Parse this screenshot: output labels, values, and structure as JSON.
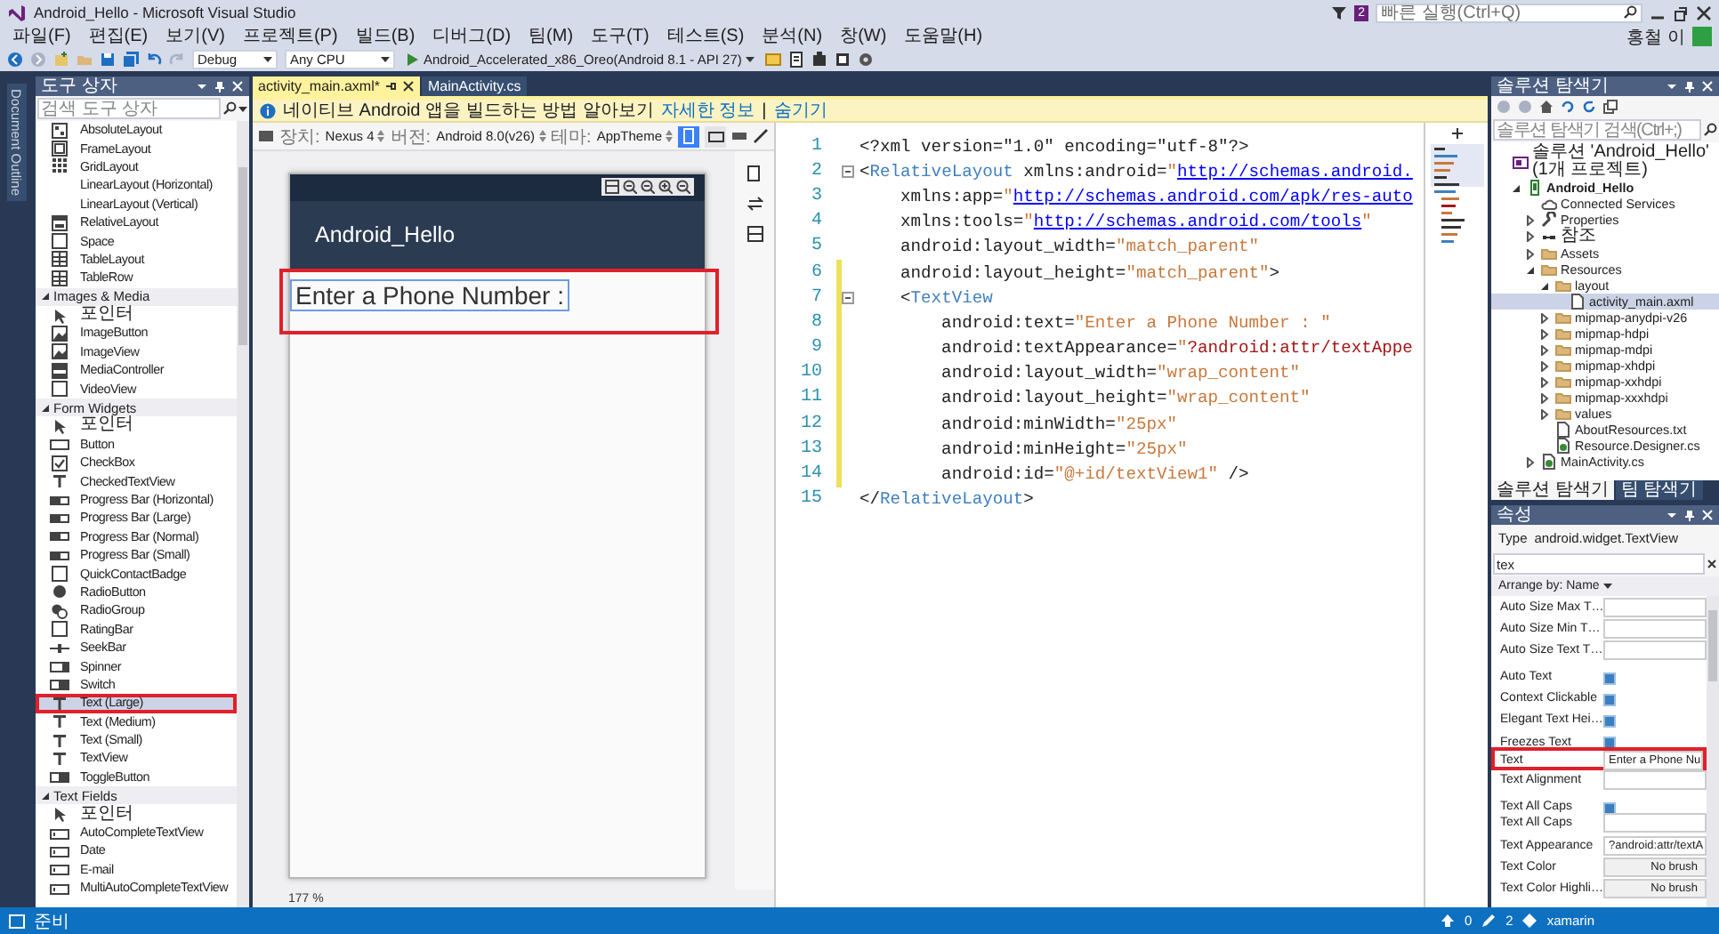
{
  "window": {
    "title": "Android_Hello - Microsoft Visual Studio",
    "notification_count": "2",
    "quick_launch": {
      "placeholder": "빠른 실행(Ctrl+Q)"
    },
    "user": "홍철 이"
  },
  "menu": [
    "파일(F)",
    "편집(E)",
    "보기(V)",
    "프로젝트(P)",
    "빌드(B)",
    "디버그(D)",
    "팀(M)",
    "도구(T)",
    "테스트(S)",
    "분석(N)",
    "창(W)",
    "도움말(H)"
  ],
  "toolbar": {
    "configuration": "Debug",
    "platform": "Any CPU",
    "device": "Android_Accelerated_x86_Oreo(Android 8.1 - API 27)"
  },
  "side_tab": "Document Outline",
  "toolbox": {
    "title": "도구 상자",
    "search": {
      "placeholder": "검색 도구 상자"
    },
    "groups": [
      {
        "items": [
          {
            "label": "AbsoluteLayout",
            "kind": "absolute",
            "selected": false
          },
          {
            "label": "FrameLayout",
            "kind": "frame",
            "selected": false
          },
          {
            "label": "GridLayout",
            "kind": "grid",
            "selected": false
          },
          {
            "label": "LinearLayout (Horizontal)",
            "kind": "linear",
            "selected": false
          },
          {
            "label": "LinearLayout (Vertical)",
            "kind": "linear",
            "selected": false
          },
          {
            "label": "RelativeLayout",
            "kind": "relative",
            "selected": false
          },
          {
            "label": "Space",
            "kind": "space",
            "selected": false
          },
          {
            "label": "TableLayout",
            "kind": "table",
            "selected": false
          },
          {
            "label": "TableRow",
            "kind": "table",
            "selected": false
          }
        ]
      },
      {
        "title": "Images & Media",
        "expanded": true,
        "items": [
          {
            "label": "포인터",
            "kind": "pointer",
            "selected": false
          },
          {
            "label": "ImageButton",
            "kind": "image",
            "selected": false
          },
          {
            "label": "ImageView",
            "kind": "image",
            "selected": false
          },
          {
            "label": "MediaController",
            "kind": "media",
            "selected": false
          },
          {
            "label": "VideoView",
            "kind": "space",
            "selected": false
          }
        ]
      },
      {
        "title": "Form Widgets",
        "expanded": true,
        "items": [
          {
            "label": "포인터",
            "kind": "pointer",
            "selected": false
          },
          {
            "label": "Button",
            "kind": "button",
            "selected": false
          },
          {
            "label": "CheckBox",
            "kind": "check",
            "selected": false
          },
          {
            "label": "CheckedTextView",
            "kind": "text",
            "selected": false
          },
          {
            "label": "Progress Bar (Horizontal)",
            "kind": "progress",
            "selected": false
          },
          {
            "label": "Progress Bar (Large)",
            "kind": "progress",
            "selected": false
          },
          {
            "label": "Progress Bar (Normal)",
            "kind": "progress",
            "selected": false
          },
          {
            "label": "Progress Bar (Small)",
            "kind": "progress",
            "selected": false
          },
          {
            "label": "QuickContactBadge",
            "kind": "space",
            "selected": false
          },
          {
            "label": "RadioButton",
            "kind": "radio",
            "selected": false
          },
          {
            "label": "RadioGroup",
            "kind": "radiogroup",
            "selected": false
          },
          {
            "label": "RatingBar",
            "kind": "space",
            "selected": false
          },
          {
            "label": "SeekBar",
            "kind": "seek",
            "selected": false
          },
          {
            "label": "Spinner",
            "kind": "spinner",
            "selected": false
          },
          {
            "label": "Switch",
            "kind": "switch",
            "selected": false
          },
          {
            "label": "Text (Large)",
            "kind": "text",
            "selected": true,
            "annotated": true
          },
          {
            "label": "Text (Medium)",
            "kind": "text",
            "selected": false
          },
          {
            "label": "Text (Small)",
            "kind": "text",
            "selected": false
          },
          {
            "label": "TextView",
            "kind": "text",
            "selected": false
          },
          {
            "label": "ToggleButton",
            "kind": "switch",
            "selected": false
          }
        ]
      },
      {
        "title": "Text Fields",
        "expanded": true,
        "items": [
          {
            "label": "포인터",
            "kind": "pointer",
            "selected": false
          },
          {
            "label": "AutoCompleteTextView",
            "kind": "field",
            "selected": false
          },
          {
            "label": "Date",
            "kind": "field",
            "selected": false
          },
          {
            "label": "E-mail",
            "kind": "field",
            "selected": false
          },
          {
            "label": "MultiAutoCompleteTextView",
            "kind": "field",
            "selected": false
          }
        ]
      }
    ]
  },
  "documents": {
    "tabs": [
      {
        "label": "activity_main.axml*",
        "selected": true
      },
      {
        "label": "MainActivity.cs",
        "selected": false
      }
    ],
    "info_bar": {
      "message": "네이티브 Android 앱을 빌드하는 방법 알아보기",
      "link": "자세한 정보",
      "separator": "|",
      "dismiss": "숨기기"
    }
  },
  "designer": {
    "fields": [
      {
        "label": "장치:",
        "value": "Nexus 4"
      },
      {
        "label": "버전:",
        "value": "Android 8.0(v26)"
      },
      {
        "label": "테마:",
        "value": "AppTheme"
      }
    ],
    "orientations": [
      {
        "kind": "portrait",
        "selected": true
      },
      {
        "kind": "landscape",
        "selected": false
      }
    ],
    "phone": {
      "app_title": "Android_Hello",
      "text_view": {
        "text": "Enter a Phone Number :",
        "selected": true,
        "annotated": true
      }
    },
    "zoom": "177 %"
  },
  "code_editor": {
    "lines": [
      {
        "number": "1",
        "changed": false,
        "fold": false,
        "tokens": [
          {
            "kind": "plain",
            "text": "<?xml version=\"1.0\" encoding=\"utf-8\"?>"
          }
        ]
      },
      {
        "number": "2",
        "changed": false,
        "fold": true,
        "tokens": [
          {
            "kind": "plain",
            "text": "<"
          },
          {
            "kind": "tag",
            "text": "RelativeLayout"
          },
          {
            "kind": "plain",
            "text": " xmlns:android="
          },
          {
            "kind": "value",
            "text": "\""
          },
          {
            "kind": "link",
            "text": "http://schemas.android."
          }
        ]
      },
      {
        "number": "3",
        "changed": false,
        "fold": false,
        "tokens": [
          {
            "kind": "plain",
            "text": "    xmlns:app="
          },
          {
            "kind": "value",
            "text": "\""
          },
          {
            "kind": "link",
            "text": "http://schemas.android.com/apk/res-auto"
          }
        ]
      },
      {
        "number": "4",
        "changed": false,
        "fold": false,
        "tokens": [
          {
            "kind": "plain",
            "text": "    xmlns:tools="
          },
          {
            "kind": "value",
            "text": "\""
          },
          {
            "kind": "link",
            "text": "http://schemas.android.com/tools"
          },
          {
            "kind": "value",
            "text": "\""
          }
        ]
      },
      {
        "number": "5",
        "changed": false,
        "fold": false,
        "tokens": [
          {
            "kind": "plain",
            "text": "    android:layout_width="
          },
          {
            "kind": "value",
            "text": "\"match_parent\""
          }
        ]
      },
      {
        "number": "6",
        "changed": true,
        "fold": false,
        "tokens": [
          {
            "kind": "plain",
            "text": "    android:layout_height="
          },
          {
            "kind": "value",
            "text": "\"match_parent\""
          },
          {
            "kind": "plain",
            "text": ">"
          }
        ]
      },
      {
        "number": "7",
        "changed": true,
        "fold": true,
        "tokens": [
          {
            "kind": "plain",
            "text": "    <"
          },
          {
            "kind": "tag",
            "text": "TextView"
          }
        ]
      },
      {
        "number": "8",
        "changed": true,
        "fold": false,
        "tokens": [
          {
            "kind": "plain",
            "text": "        android:text="
          },
          {
            "kind": "value",
            "text": "\"Enter a Phone Number : \""
          }
        ]
      },
      {
        "number": "9",
        "changed": true,
        "fold": false,
        "tokens": [
          {
            "kind": "plain",
            "text": "        android:textAppearance="
          },
          {
            "kind": "value",
            "text": "\""
          },
          {
            "kind": "resource",
            "text": "?android:attr/textAppe"
          }
        ]
      },
      {
        "number": "10",
        "changed": true,
        "fold": false,
        "tokens": [
          {
            "kind": "plain",
            "text": "        android:layout_width="
          },
          {
            "kind": "value",
            "text": "\"wrap_content\""
          }
        ]
      },
      {
        "number": "11",
        "changed": true,
        "fold": false,
        "tokens": [
          {
            "kind": "plain",
            "text": "        android:layout_height="
          },
          {
            "kind": "value",
            "text": "\"wrap_content\""
          }
        ]
      },
      {
        "number": "12",
        "changed": true,
        "fold": false,
        "tokens": [
          {
            "kind": "plain",
            "text": "        android:minWidth="
          },
          {
            "kind": "value",
            "text": "\"25px\""
          }
        ]
      },
      {
        "number": "13",
        "changed": true,
        "fold": false,
        "tokens": [
          {
            "kind": "plain",
            "text": "        android:minHeight="
          },
          {
            "kind": "value",
            "text": "\"25px\""
          }
        ]
      },
      {
        "number": "14",
        "changed": true,
        "fold": false,
        "tokens": [
          {
            "kind": "plain",
            "text": "        android:id="
          },
          {
            "kind": "value",
            "text": "\"@+id/textView1\""
          },
          {
            "kind": "plain",
            "text": " />"
          }
        ]
      },
      {
        "number": "15",
        "changed": false,
        "fold": false,
        "tokens": [
          {
            "kind": "plain",
            "text": "</"
          },
          {
            "kind": "tag",
            "text": "RelativeLayout"
          },
          {
            "kind": "plain",
            "text": ">"
          }
        ]
      }
    ]
  },
  "solution_explorer": {
    "title": "솔루션 탐색기",
    "search": {
      "placeholder": "솔루션 탐색기 검색(Ctrl+;)"
    },
    "tree": [
      {
        "label": "솔루션 'Android_Hello' (1개 프로젝트)",
        "kind": "solution",
        "selected": false,
        "children": [
          {
            "label": "Android_Hello",
            "kind": "project",
            "expanded": true,
            "startup": true,
            "selected": false,
            "children": [
              {
                "label": "Connected Services",
                "kind": "cloud",
                "selected": false
              },
              {
                "label": "Properties",
                "kind": "wrench",
                "expanded": false,
                "selected": false
              },
              {
                "label": "참조",
                "kind": "refs",
                "expanded": false,
                "selected": false
              },
              {
                "label": "Assets",
                "kind": "folder",
                "expanded": false,
                "selected": false
              },
              {
                "label": "Resources",
                "kind": "folder",
                "expanded": true,
                "selected": false,
                "children": [
                  {
                    "label": "layout",
                    "kind": "folder",
                    "expanded": true,
                    "selected": false,
                    "children": [
                      {
                        "label": "activity_main.axml",
                        "kind": "file",
                        "selected": true
                      }
                    ]
                  },
                  {
                    "label": "mipmap-anydpi-v26",
                    "kind": "folder",
                    "expanded": false,
                    "selected": false
                  },
                  {
                    "label": "mipmap-hdpi",
                    "kind": "folder",
                    "expanded": false,
                    "selected": false
                  },
                  {
                    "label": "mipmap-mdpi",
                    "kind": "folder",
                    "expanded": false,
                    "selected": false
                  },
                  {
                    "label": "mipmap-xhdpi",
                    "kind": "folder",
                    "expanded": false,
                    "selected": false
                  },
                  {
                    "label": "mipmap-xxhdpi",
                    "kind": "folder",
                    "expanded": false,
                    "selected": false
                  },
                  {
                    "label": "mipmap-xxxhdpi",
                    "kind": "folder",
                    "expanded": false,
                    "selected": false
                  },
                  {
                    "label": "values",
                    "kind": "folder",
                    "expanded": false,
                    "selected": false
                  },
                  {
                    "label": "AboutResources.txt",
                    "kind": "file",
                    "selected": false
                  },
                  {
                    "label": "Resource.Designer.cs",
                    "kind": "cs",
                    "selected": false
                  }
                ]
              },
              {
                "label": "MainActivity.cs",
                "kind": "cs",
                "expanded": false,
                "selected": false
              }
            ]
          }
        ]
      }
    ],
    "tabs": [
      {
        "label": "솔루션 탐색기",
        "selected": true
      },
      {
        "label": "팀 탐색기",
        "selected": false
      }
    ]
  },
  "properties": {
    "title": "속성",
    "type_label": "Type",
    "type_value": "android.widget.TextView",
    "search": {
      "value": "tex"
    },
    "arrange": "Arrange by: Name",
    "rows": [
      {
        "name": "Auto Size Max T…",
        "kind": "field"
      },
      {
        "name": "Auto Size Min T…",
        "kind": "field"
      },
      {
        "name": "Auto Size Text T…",
        "kind": "field"
      },
      {
        "name": "Auto Text",
        "kind": "toggle",
        "checked": true
      },
      {
        "name": "Context Clickable",
        "kind": "toggle",
        "checked": true
      },
      {
        "name": "Elegant Text Hei…",
        "kind": "toggle",
        "checked": true
      },
      {
        "name": "Freezes Text",
        "kind": "toggle",
        "checked": true
      },
      {
        "name": "Text",
        "kind": "field",
        "value": "Enter a Phone Nu",
        "annotated": true
      },
      {
        "name": "Text Alignment",
        "kind": "field"
      },
      {
        "name": "Text All Caps",
        "kind": "toggle",
        "checked": true
      },
      {
        "name": "Text All Caps",
        "kind": "field"
      },
      {
        "name": "Text Appearance",
        "kind": "field",
        "value": "?android:attr/textA"
      },
      {
        "name": "Text Color",
        "kind": "brush",
        "value": "No brush"
      },
      {
        "name": "Text Color Highli…",
        "kind": "brush",
        "value": "No brush"
      }
    ]
  },
  "status_bar": {
    "message": "준비",
    "items": [
      {
        "kind": "up",
        "text": "0"
      },
      {
        "kind": "pencil",
        "text": "2"
      },
      {
        "kind": "diamond",
        "text": "xamarin"
      }
    ]
  }
}
